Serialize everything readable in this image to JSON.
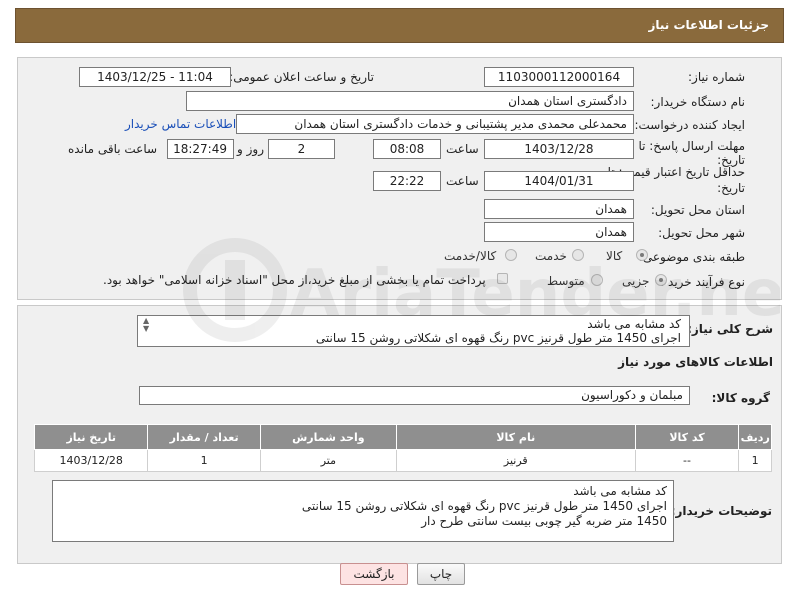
{
  "header": {
    "title": "جزئیات اطلاعات نیاز"
  },
  "fields": {
    "need_number_label": "شماره نیاز:",
    "need_number": "1103000112000164",
    "announce_label": "تاریخ و ساعت اعلان عمومی:",
    "announce_value": "1403/12/25 - 11:04",
    "buyer_org_label": "نام دستگاه خریدار:",
    "buyer_org": "دادگستری استان همدان",
    "creator_label": "ایجاد کننده درخواست:",
    "creator": "محمدعلی محمدی مدیر پشتیبانی و خدمات دادگستری استان همدان",
    "contact_link": "اطلاعات تماس خریدار",
    "deadline_label_1": "مهلت ارسال پاسخ: تا",
    "deadline_label_2": "تاریخ:",
    "deadline_date": "1403/12/28",
    "hour_label": "ساعت",
    "deadline_time": "08:08",
    "days_value": "2",
    "days_label": "روز و",
    "remaining_value": "18:27:49",
    "remaining_label": "ساعت باقی مانده",
    "validity_label_1": "حداقل تاریخ اعتبار قیمت: تا",
    "validity_label_2": "تاریخ:",
    "validity_date": "1404/01/31",
    "validity_hour_label": "ساعت",
    "validity_time": "22:22",
    "province_label": "استان محل تحویل:",
    "province": "همدان",
    "city_label": "شهر محل تحویل:",
    "city": "همدان",
    "category_label": "طبقه بندی موضوعی:",
    "category_options": [
      "کالا",
      "خدمت",
      "کالا/خدمت"
    ],
    "category_selected": "کالا",
    "process_label": "نوع فرآیند خرید :",
    "process_options": [
      "جزیی",
      "متوسط"
    ],
    "process_selected": "جزیی",
    "payment_note": "پرداخت تمام یا بخشی از مبلغ خرید،از محل \"اسناد خزانه اسلامی\" خواهد بود."
  },
  "description": {
    "label": "شرح کلی نیاز:",
    "lines": [
      "کد مشابه می باشد",
      "اجرای  1450 متر طول قرنیز pvc   رنگ قهوه ای شکلاتی روشن  15 سانتی"
    ]
  },
  "goods": {
    "section_title": "اطلاعات کالاهای مورد نیاز",
    "group_label": "گروه کالا:",
    "group_value": "مبلمان و دکوراسیون",
    "columns": [
      "ردیف",
      "کد کالا",
      "نام کالا",
      "واحد شمارش",
      "تعداد / مقدار",
      "تاریخ نیاز"
    ],
    "rows": [
      {
        "row": "1",
        "code": "--",
        "name": "قرنیز",
        "unit": "متر",
        "qty": "1",
        "date": "1403/12/28"
      }
    ]
  },
  "buyer_notes": {
    "label": "توضیحات خریدار:",
    "lines": [
      "کد مشابه می باشد",
      "اجرای  1450 متر طول قرنیز pvc   رنگ قهوه ای شکلاتی روشن  15 سانتی",
      "1450 متر ضربه گیر چوبی بیست سانتی طرح دار"
    ]
  },
  "buttons": {
    "print": "چاپ",
    "back": "بازگشت"
  },
  "watermark": {
    "text": "AriaTender.neT"
  },
  "colors": {
    "header": "#8a6a3c",
    "table_header": "#8f8f8f",
    "link": "#1a4fb8",
    "back_button": "#fde3e3"
  }
}
